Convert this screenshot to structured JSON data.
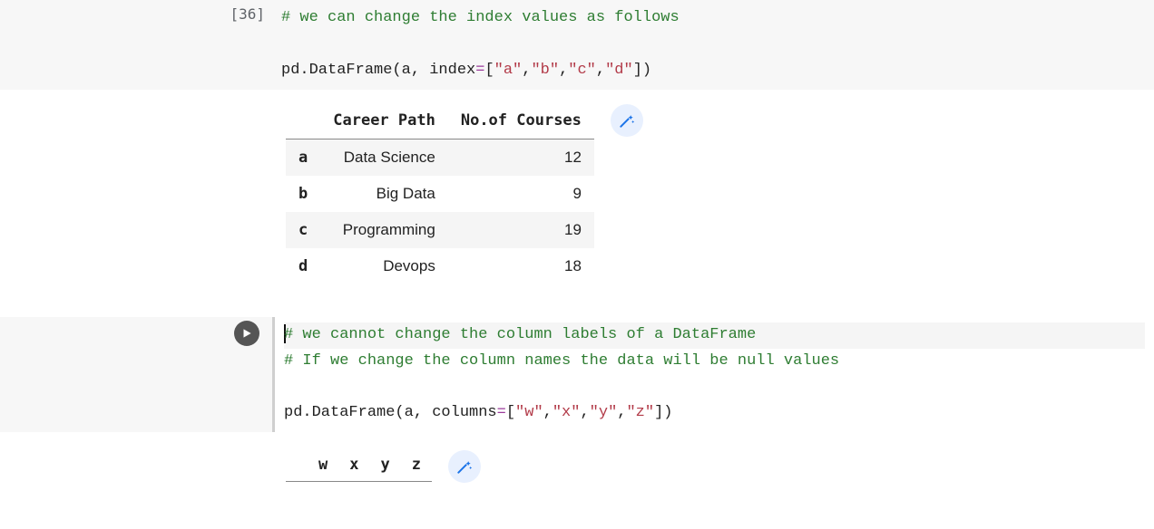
{
  "cell1": {
    "prompt": "[36]",
    "comment_line": "# we can change the index values as follows",
    "code_prefix": "pd.DataFrame(a, index",
    "eq": "=",
    "br_open": "[",
    "br_close": "]",
    "paren_close": ")",
    "comma": ",",
    "str_a": "\"a\"",
    "str_b": "\"b\"",
    "str_c": "\"c\"",
    "str_d": "\"d\""
  },
  "table1": {
    "col1": "Career Path",
    "col2": "No.of Courses",
    "rows": [
      {
        "idx": "a",
        "c1": "Data Science",
        "c2": "12"
      },
      {
        "idx": "b",
        "c1": "Big Data",
        "c2": "9"
      },
      {
        "idx": "c",
        "c1": "Programming",
        "c2": "19"
      },
      {
        "idx": "d",
        "c1": "Devops",
        "c2": "18"
      }
    ]
  },
  "cell2": {
    "comment_line1": "# we cannot change the column labels of a DataFrame",
    "comment_line2": "# If we change the column names the data will be null values",
    "code_prefix": "pd.DataFrame(a, columns",
    "eq": "=",
    "br_open": "[",
    "br_close": "]",
    "paren_close": ")",
    "comma": ",",
    "str_w": "\"w\"",
    "str_x": "\"x\"",
    "str_y": "\"y\"",
    "str_z": "\"z\""
  },
  "table2": {
    "c1": "w",
    "c2": "x",
    "c3": "y",
    "c4": "z"
  }
}
